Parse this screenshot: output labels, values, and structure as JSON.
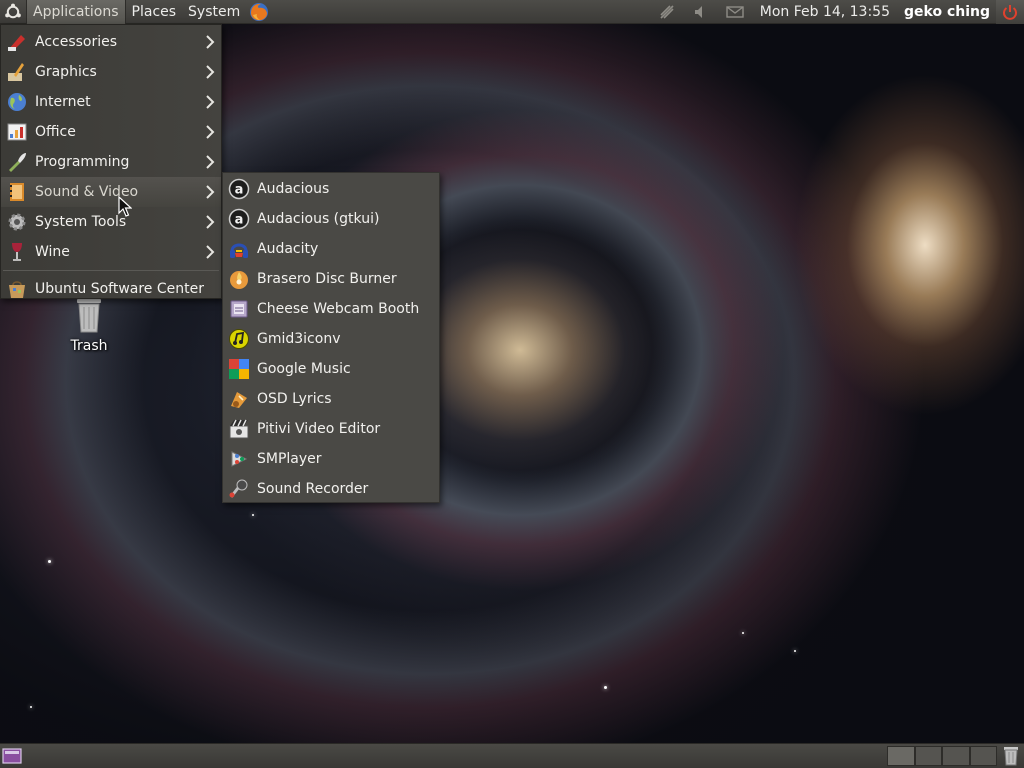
{
  "top_panel": {
    "applications_label": "Applications",
    "places_label": "Places",
    "system_label": "System",
    "clock": "Mon Feb 14, 13:55",
    "user": "geko ching"
  },
  "applications_menu": {
    "items": [
      {
        "label": "Accessories",
        "icon": "accessories-icon",
        "has_submenu": true
      },
      {
        "label": "Graphics",
        "icon": "graphics-icon",
        "has_submenu": true
      },
      {
        "label": "Internet",
        "icon": "internet-globe-icon",
        "has_submenu": true
      },
      {
        "label": "Office",
        "icon": "office-icon",
        "has_submenu": true
      },
      {
        "label": "Programming",
        "icon": "programming-icon",
        "has_submenu": true
      },
      {
        "label": "Sound & Video",
        "icon": "sound-video-icon",
        "has_submenu": true,
        "highlighted": true
      },
      {
        "label": "System Tools",
        "icon": "system-tools-gear-icon",
        "has_submenu": true
      },
      {
        "label": "Wine",
        "icon": "wine-glass-icon",
        "has_submenu": true
      }
    ],
    "footer_item": {
      "label": "Ubuntu Software Center",
      "icon": "software-center-icon"
    }
  },
  "sound_video_submenu": {
    "items": [
      {
        "label": "Audacious",
        "icon": "audacious-icon"
      },
      {
        "label": "Audacious (gtkui)",
        "icon": "audacious-gtkui-icon"
      },
      {
        "label": "Audacity",
        "icon": "audacity-icon"
      },
      {
        "label": "Brasero Disc Burner",
        "icon": "brasero-icon"
      },
      {
        "label": "Cheese Webcam Booth",
        "icon": "cheese-icon"
      },
      {
        "label": "Gmid3iconv",
        "icon": "gmid3iconv-icon"
      },
      {
        "label": "Google Music",
        "icon": "google-music-icon"
      },
      {
        "label": "OSD Lyrics",
        "icon": "osd-lyrics-icon"
      },
      {
        "label": "Pitivi Video Editor",
        "icon": "pitivi-icon"
      },
      {
        "label": "SMPlayer",
        "icon": "smplayer-icon"
      },
      {
        "label": "Sound Recorder",
        "icon": "sound-recorder-icon"
      }
    ]
  },
  "desktop": {
    "trash_label": "Trash"
  },
  "colors": {
    "panel": "#3f3e3a",
    "menu": "#403f3b",
    "submenu": "#4a4945",
    "highlight": "#4f4d49"
  }
}
